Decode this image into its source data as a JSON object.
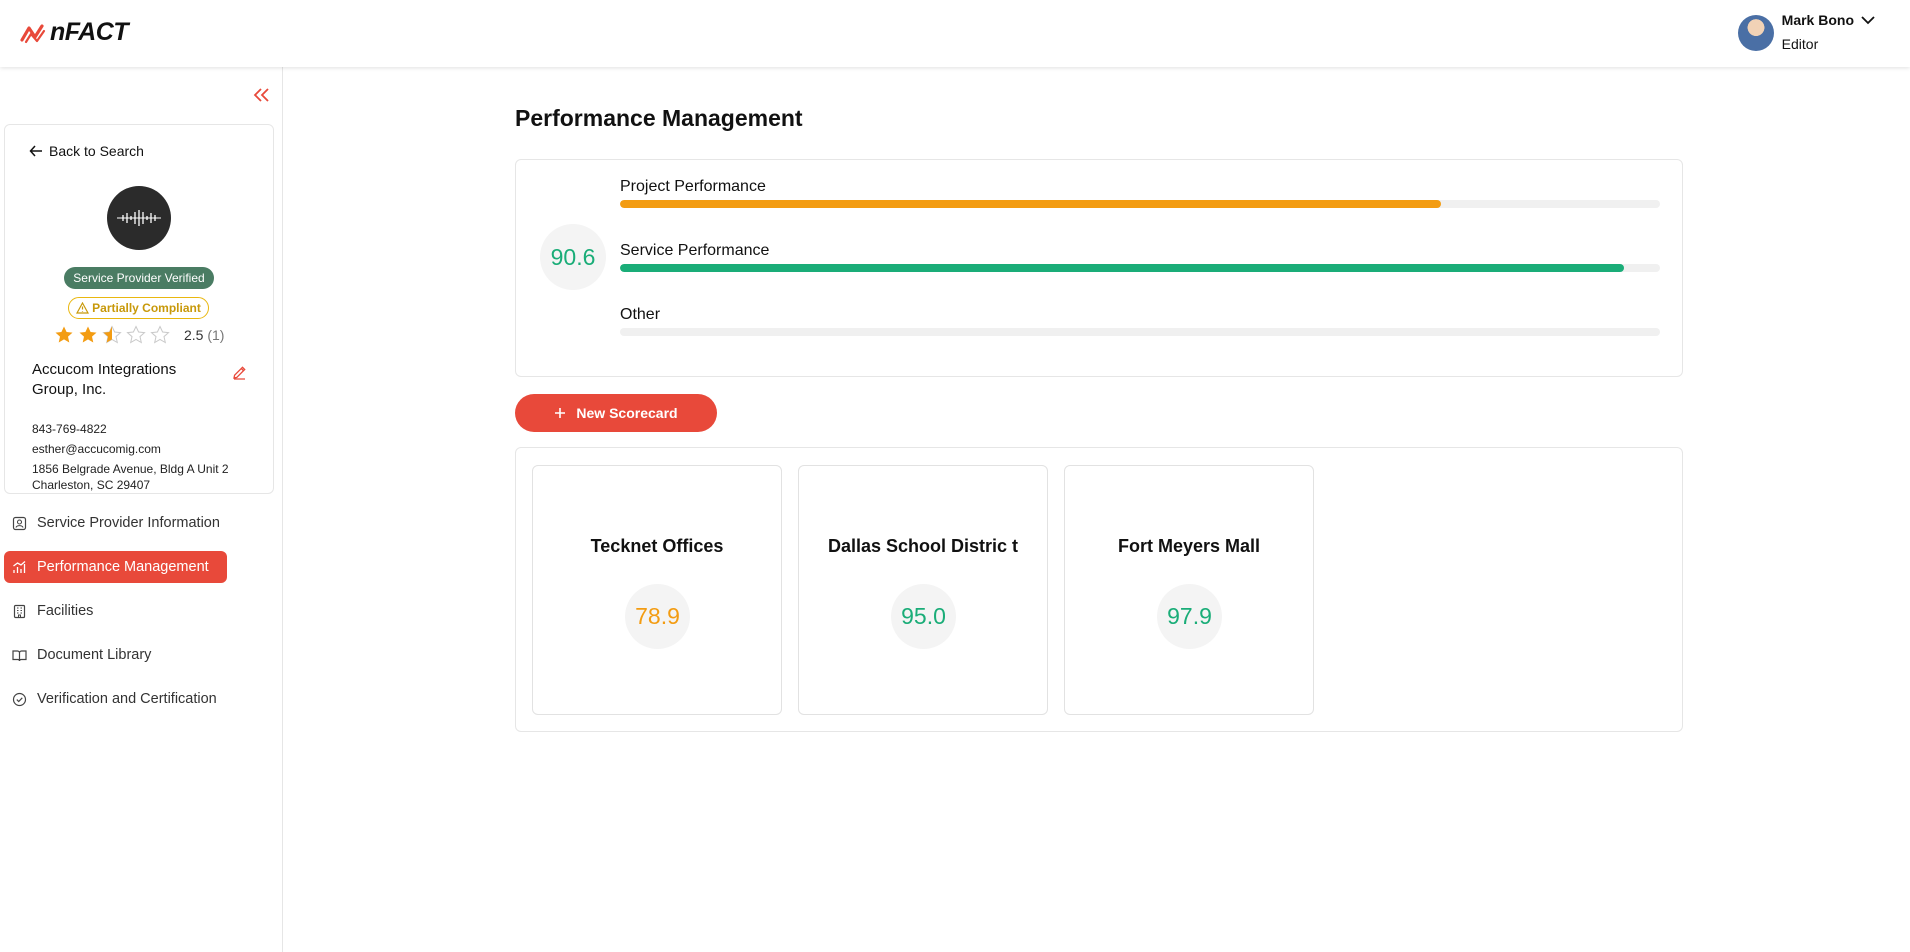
{
  "app": {
    "logo_text": "nFACT"
  },
  "user": {
    "name": "Mark Bono",
    "role": "Editor"
  },
  "profile": {
    "back_label": "Back to Search",
    "badge_verified": "Service Provider Verified",
    "badge_partial": "Partially Compliant",
    "rating_value": "2.5",
    "rating_count": "(1)",
    "rating_stars": 2.5,
    "company_name": "Accucom Integrations Group, Inc.",
    "phone": "843-769-4822",
    "email": "esther@accucomig.com",
    "address_line1": "1856 Belgrade Avenue, Bldg A Unit 2",
    "address_line2": "Charleston, SC 29407"
  },
  "nav": {
    "items": [
      {
        "label": "Service Provider Information"
      },
      {
        "label": "Performance Management"
      },
      {
        "label": "Facilities"
      },
      {
        "label": "Document Library"
      },
      {
        "label": "Verification and Certification"
      }
    ]
  },
  "main": {
    "title": "Performance Management",
    "overall_score": "90.6",
    "bars": [
      {
        "label": "Project Performance",
        "fill_percent": 78.9,
        "color": "#f39c12"
      },
      {
        "label": "Service Performance",
        "fill_percent": 96.5,
        "color": "#1aad78"
      },
      {
        "label": "Other",
        "fill_percent": 0,
        "color": "#cccccc"
      }
    ],
    "new_button_label": "New Scorecard",
    "scorecards": [
      {
        "title": "Tecknet Offices",
        "score": "78.9",
        "color": "#f39c12"
      },
      {
        "title": "Dallas School Distric t",
        "score": "95.0",
        "color": "#1aad78"
      },
      {
        "title": "Fort Meyers Mall",
        "score": "97.9",
        "color": "#1aad78"
      }
    ]
  },
  "colors": {
    "accent": "#e8493a",
    "verified": "#4a7c63",
    "warning": "#e9b70f",
    "star": "#f39c12"
  }
}
